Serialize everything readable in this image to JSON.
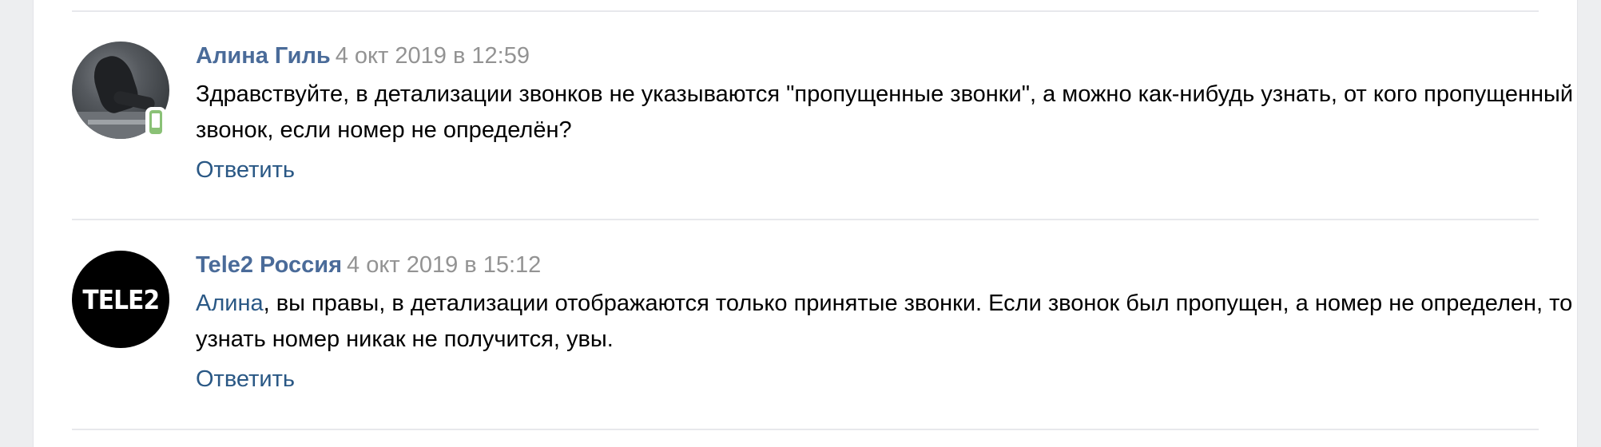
{
  "comments": [
    {
      "author": "Алина Гиль",
      "date": "4 окт 2019 в 12:59",
      "text": "Здравствуйте, в детализации звонков не указываются \"пропущенные звонки\", а можно как-нибудь узнать, от кого пропущенный звонок, если номер не определён?",
      "reply_label": "Ответить",
      "avatar_icon": "user-photo",
      "status_icon": "mobile-online-icon"
    },
    {
      "author": "Tele2 Россия",
      "date": "4 окт 2019 в 15:12",
      "mention": "Алина",
      "text": ", вы правы, в детализации отображаются только принятые звонки. Если звонок был пропущен, а номер не определен, то узнать номер никак не получится, увы.",
      "reply_label": "Ответить",
      "avatar_logo_text": "TELE2"
    }
  ],
  "colors": {
    "page_background": "#edeef0",
    "author_link": "#4a6b99",
    "link": "#2a5885",
    "date": "#939393",
    "online": "#8ac176"
  }
}
